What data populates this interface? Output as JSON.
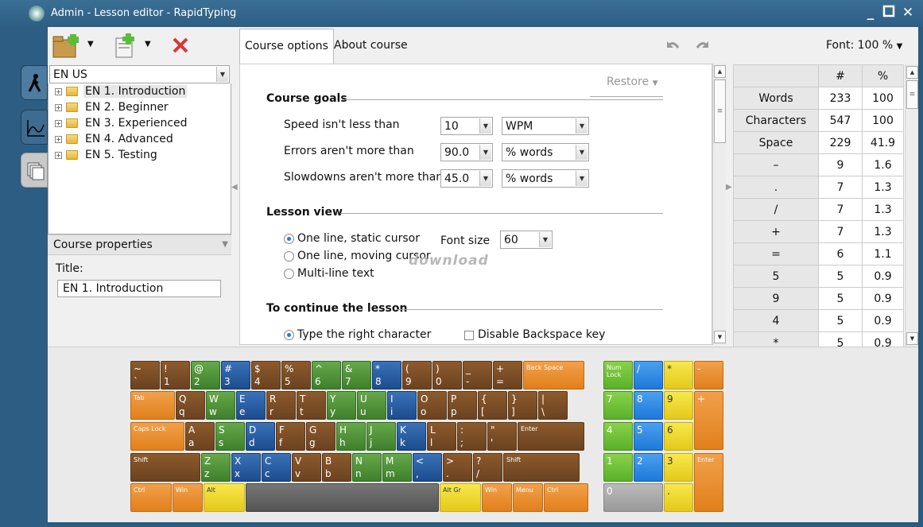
{
  "window": {
    "title": "Admin - Lesson editor - RapidTyping"
  },
  "left": {
    "language": "EN US",
    "tree": [
      {
        "label": "EN 1. Introduction",
        "selected": true
      },
      {
        "label": "EN 2. Beginner"
      },
      {
        "label": "EN 3. Experienced"
      },
      {
        "label": "EN 4. Advanced"
      },
      {
        "label": "EN 5. Testing"
      }
    ],
    "properties_header": "Course properties",
    "title_label": "Title:",
    "title_value": "EN 1. Introduction"
  },
  "tabs": {
    "course_options": "Course options",
    "about_course": "About course"
  },
  "options": {
    "restore": "Restore",
    "goals_heading": "Course goals",
    "speed_label": "Speed isn't less than",
    "speed_value": "10",
    "speed_unit": "WPM",
    "errors_label": "Errors aren't more than",
    "errors_value": "90.0",
    "errors_unit": "% words",
    "slow_label": "Slowdowns aren't more than",
    "slow_value": "45.0",
    "slow_unit": "% words",
    "view_heading": "Lesson view",
    "view_opt1": "One line, static cursor",
    "view_opt2": "One line, moving cursor",
    "view_opt3": "Multi-line text",
    "font_size_label": "Font size",
    "font_size_value": "60",
    "continue_heading": "To continue the lesson",
    "continue_opt1": "Type the right character",
    "disable_backspace": "Disable Backspace key"
  },
  "watermark": "download",
  "stats": {
    "font_label": "Font: 100 %",
    "col_count": "#",
    "col_pct": "%",
    "rows": [
      {
        "char": "Words",
        "count": "233",
        "pct": "100"
      },
      {
        "char": "Characters",
        "count": "547",
        "pct": "100"
      },
      {
        "char": "Space",
        "count": "229",
        "pct": "41.9"
      },
      {
        "char": "–",
        "count": "9",
        "pct": "1.6"
      },
      {
        "char": ".",
        "count": "7",
        "pct": "1.3"
      },
      {
        "char": "/",
        "count": "7",
        "pct": "1.3"
      },
      {
        "char": "+",
        "count": "7",
        "pct": "1.3"
      },
      {
        "char": "=",
        "count": "6",
        "pct": "1.1"
      },
      {
        "char": "5",
        "count": "5",
        "pct": "0.9"
      },
      {
        "char": "9",
        "count": "5",
        "pct": "0.9"
      },
      {
        "char": "4",
        "count": "5",
        "pct": "0.9"
      },
      {
        "char": "*",
        "count": "5",
        "pct": "0.9"
      }
    ]
  },
  "keyboard": {
    "row1": [
      [
        "~",
        "`",
        "brown"
      ],
      [
        "!",
        "1",
        "brown"
      ],
      [
        "@",
        "2",
        "green"
      ],
      [
        "#",
        "3",
        "blue"
      ],
      [
        "$",
        "4",
        "brown"
      ],
      [
        "%",
        "5",
        "brown"
      ],
      [
        "^",
        "6",
        "green"
      ],
      [
        "&",
        "7",
        "green"
      ],
      [
        "*",
        "8",
        "blue"
      ],
      [
        "(",
        "9",
        "brown"
      ],
      [
        ")",
        "0",
        "brown"
      ],
      [
        "_",
        "-",
        "brown"
      ],
      [
        "+",
        "=",
        "brown"
      ]
    ],
    "backspace": "Back Space",
    "row2": [
      [
        "Q",
        "q",
        "brown"
      ],
      [
        "W",
        "w",
        "green"
      ],
      [
        "E",
        "e",
        "blue"
      ],
      [
        "R",
        "r",
        "brown"
      ],
      [
        "T",
        "t",
        "brown"
      ],
      [
        "Y",
        "y",
        "green"
      ],
      [
        "U",
        "u",
        "green"
      ],
      [
        "I",
        "i",
        "blue"
      ],
      [
        "O",
        "o",
        "brown"
      ],
      [
        "P",
        "p",
        "brown"
      ],
      [
        "{",
        "[",
        "brown"
      ],
      [
        "}",
        "]",
        "brown"
      ],
      [
        "|",
        "\\",
        "brown"
      ]
    ],
    "tab": "Tab",
    "row3": [
      [
        "A",
        "a",
        "brown"
      ],
      [
        "S",
        "s",
        "green"
      ],
      [
        "D",
        "d",
        "blue"
      ],
      [
        "F",
        "f",
        "brown"
      ],
      [
        "G",
        "g",
        "brown"
      ],
      [
        "H",
        "h",
        "green"
      ],
      [
        "J",
        "j",
        "green"
      ],
      [
        "K",
        "k",
        "blue"
      ],
      [
        "L",
        "l",
        "brown"
      ],
      [
        ":",
        ";",
        "brown"
      ],
      [
        "\"",
        "'",
        "brown"
      ]
    ],
    "caps": "Caps Lock",
    "enter": "Enter",
    "row4": [
      [
        "Z",
        "z",
        "green"
      ],
      [
        "X",
        "x",
        "blue"
      ],
      [
        "C",
        "c",
        "blue"
      ],
      [
        "V",
        "v",
        "brown"
      ],
      [
        "B",
        "b",
        "brown"
      ],
      [
        "N",
        "n",
        "green"
      ],
      [
        "M",
        "m",
        "green"
      ],
      [
        "<",
        ",",
        "blue"
      ],
      [
        ">",
        ".",
        "brown"
      ],
      [
        "?",
        "/",
        "brown"
      ]
    ],
    "shift": "Shift",
    "ctrl": "Ctrl",
    "win": "Win",
    "alt": "Alt",
    "altgr": "Alt Gr",
    "menu": "Menu",
    "numpad": {
      "numlock": "Num Lock",
      "div": "/",
      "mul": "*",
      "minus": "-",
      "n7": "7",
      "n8": "8",
      "n9": "9",
      "plus": "+",
      "n4": "4",
      "n5": "5",
      "n6": "6",
      "n1": "1",
      "n2": "2",
      "n3": "3",
      "enter": "Enter",
      "n0": "0",
      "dot": "."
    }
  }
}
